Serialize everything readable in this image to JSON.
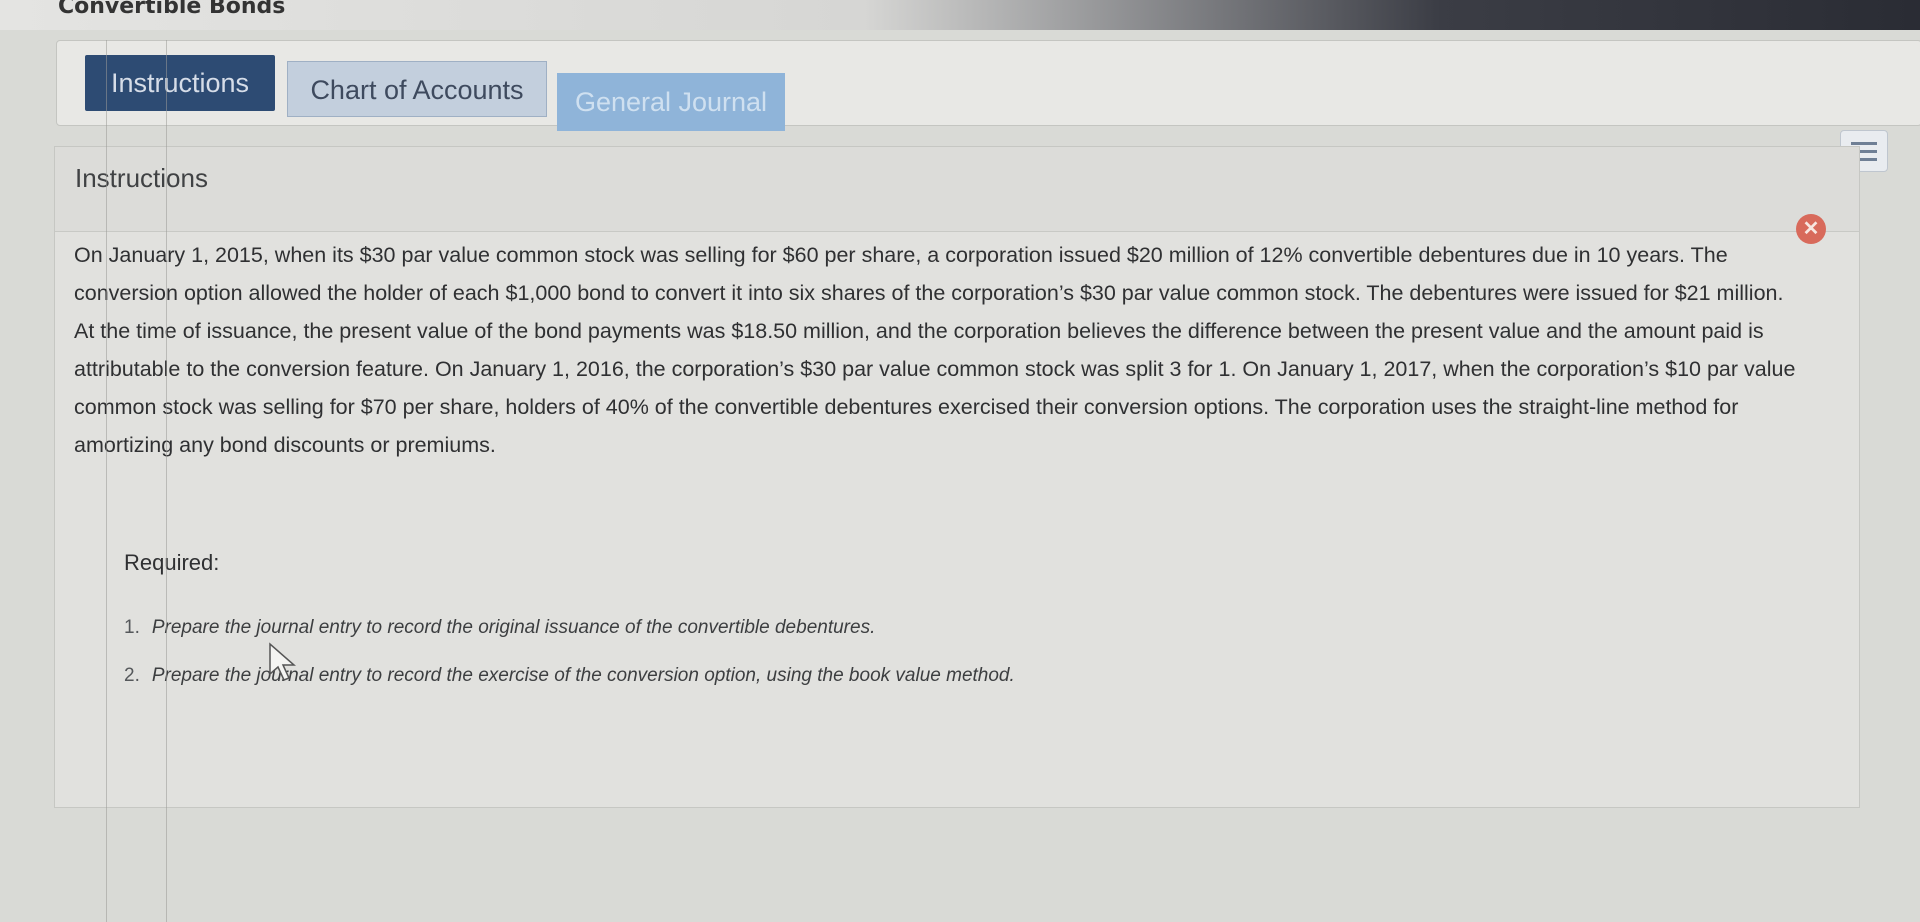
{
  "window": {
    "title": "Convertible Bonds"
  },
  "tabs": [
    {
      "label": "Instructions",
      "state": "active"
    },
    {
      "label": "Chart of Accounts",
      "state": "inactive"
    },
    {
      "label": "General Journal",
      "state": "inactive"
    }
  ],
  "toolbar": {
    "menu_icon": "hamburger-menu-icon"
  },
  "panel": {
    "heading": "Instructions",
    "close_icon": "close-icon",
    "problem_lines": [
      "On January 1, 2015, when its $30 par value common stock was selling for $60 per share, a corporation issued $20 million of 12% convertible debentures due in 10 years. The",
      "conversion option allowed the holder of each $1,000 bond to convert it into six shares of the corporation’s $30 par value common stock. The debentures were issued for $21 million.",
      "At the time of issuance, the present value of the bond payments was $18.50 million, and the corporation believes the difference between the present value and the amount paid is",
      "attributable to the conversion feature. On January 1, 2016, the corporation’s $30 par value common stock was split 3 for 1. On January 1, 2017, when the corporation’s $10 par value",
      "common stock was selling for $70 per share, holders of 40% of the convertible debentures exercised their conversion options. The corporation uses the straight-line method for",
      "amortizing any bond discounts or premiums."
    ],
    "required": {
      "title": "Required:",
      "items": [
        {
          "number": "1.",
          "text": "Prepare the journal entry to record the original issuance of the convertible debentures."
        },
        {
          "number": "2.",
          "text": "Prepare the journal entry to record the exercise of the conversion option, using the book value method."
        }
      ]
    }
  },
  "colors": {
    "active_tab": "#2d4b73",
    "inactive_tab": "#c3cfdd",
    "journal_tab": "#8fb4d9",
    "close_button": "#d86a5b"
  }
}
